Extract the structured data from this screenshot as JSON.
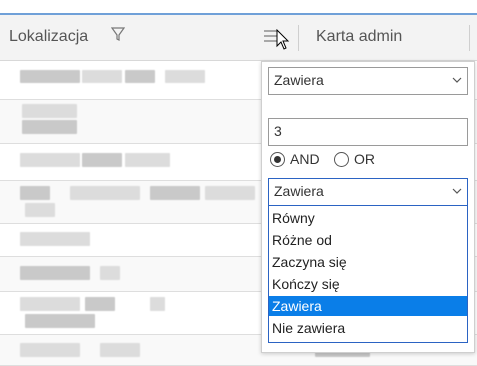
{
  "header": {
    "col1_label": "Lokalizacja",
    "col2_label": "Karta admin"
  },
  "filter": {
    "condition1": "Zawiera",
    "value1": "3",
    "logic_and": "AND",
    "logic_or": "OR",
    "selected_logic": "AND",
    "condition2": "Zawiera",
    "options": [
      "Równy",
      "Różne od",
      "Zaczyna się",
      "Kończy się",
      "Zawiera",
      "Nie zawiera"
    ],
    "selected_option": "Zawiera"
  },
  "colors": {
    "accent_border": "#6fa0d8",
    "selection": "#0a7ee8",
    "listbox_border": "#2b63c3"
  }
}
